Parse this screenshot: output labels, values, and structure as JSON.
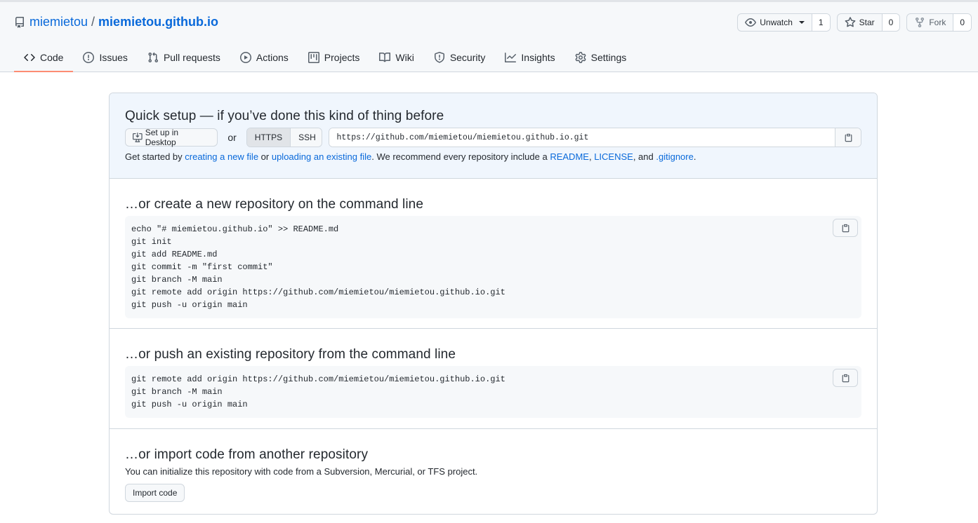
{
  "repo": {
    "owner": "miemietou",
    "separator": "/",
    "name": "miemietou.github.io"
  },
  "header_actions": {
    "watch": {
      "label": "Unwatch",
      "count": "1"
    },
    "star": {
      "label": "Star",
      "count": "0"
    },
    "fork": {
      "label": "Fork",
      "count": "0"
    }
  },
  "tabs": [
    {
      "label": "Code",
      "icon": "code-icon",
      "selected": true
    },
    {
      "label": "Issues",
      "icon": "issue-icon"
    },
    {
      "label": "Pull requests",
      "icon": "pull-request-icon"
    },
    {
      "label": "Actions",
      "icon": "play-icon"
    },
    {
      "label": "Projects",
      "icon": "project-icon"
    },
    {
      "label": "Wiki",
      "icon": "book-icon"
    },
    {
      "label": "Security",
      "icon": "shield-icon"
    },
    {
      "label": "Insights",
      "icon": "graph-icon"
    },
    {
      "label": "Settings",
      "icon": "gear-icon"
    }
  ],
  "quick_setup": {
    "title": "Quick setup — if you’ve done this kind of thing before",
    "desktop_button": "Set up in Desktop",
    "or_text": "or",
    "https_label": "HTTPS",
    "ssh_label": "SSH",
    "clone_url": "https://github.com/miemietou/miemietou.github.io.git",
    "hint": {
      "part1": "Get started by ",
      "link_new_file": "creating a new file",
      "part2": " or ",
      "link_upload": "uploading an existing file",
      "part3": ". We recommend every repository include a ",
      "link_readme": "README",
      "comma1": ", ",
      "link_license": "LICENSE",
      "part4": ", and ",
      "link_gitignore": ".gitignore",
      "end": "."
    }
  },
  "create_section": {
    "title": "…or create a new repository on the command line",
    "lines": [
      "echo \"# miemietou.github.io\" >> README.md",
      "git init",
      "git add README.md",
      "git commit -m \"first commit\"",
      "git branch -M main",
      "git remote add origin https://github.com/miemietou/miemietou.github.io.git",
      "git push -u origin main"
    ]
  },
  "push_section": {
    "title": "…or push an existing repository from the command line",
    "lines": [
      "git remote add origin https://github.com/miemietou/miemietou.github.io.git",
      "git branch -M main",
      "git push -u origin main"
    ]
  },
  "import_section": {
    "title": "…or import code from another repository",
    "description": "You can initialize this repository with code from a Subversion, Mercurial, or TFS project.",
    "button": "Import code"
  },
  "colors": {
    "link": "#0969da",
    "selected_tab_underline": "#fd8c73",
    "quick_setup_bg": "#f0f6fd"
  }
}
